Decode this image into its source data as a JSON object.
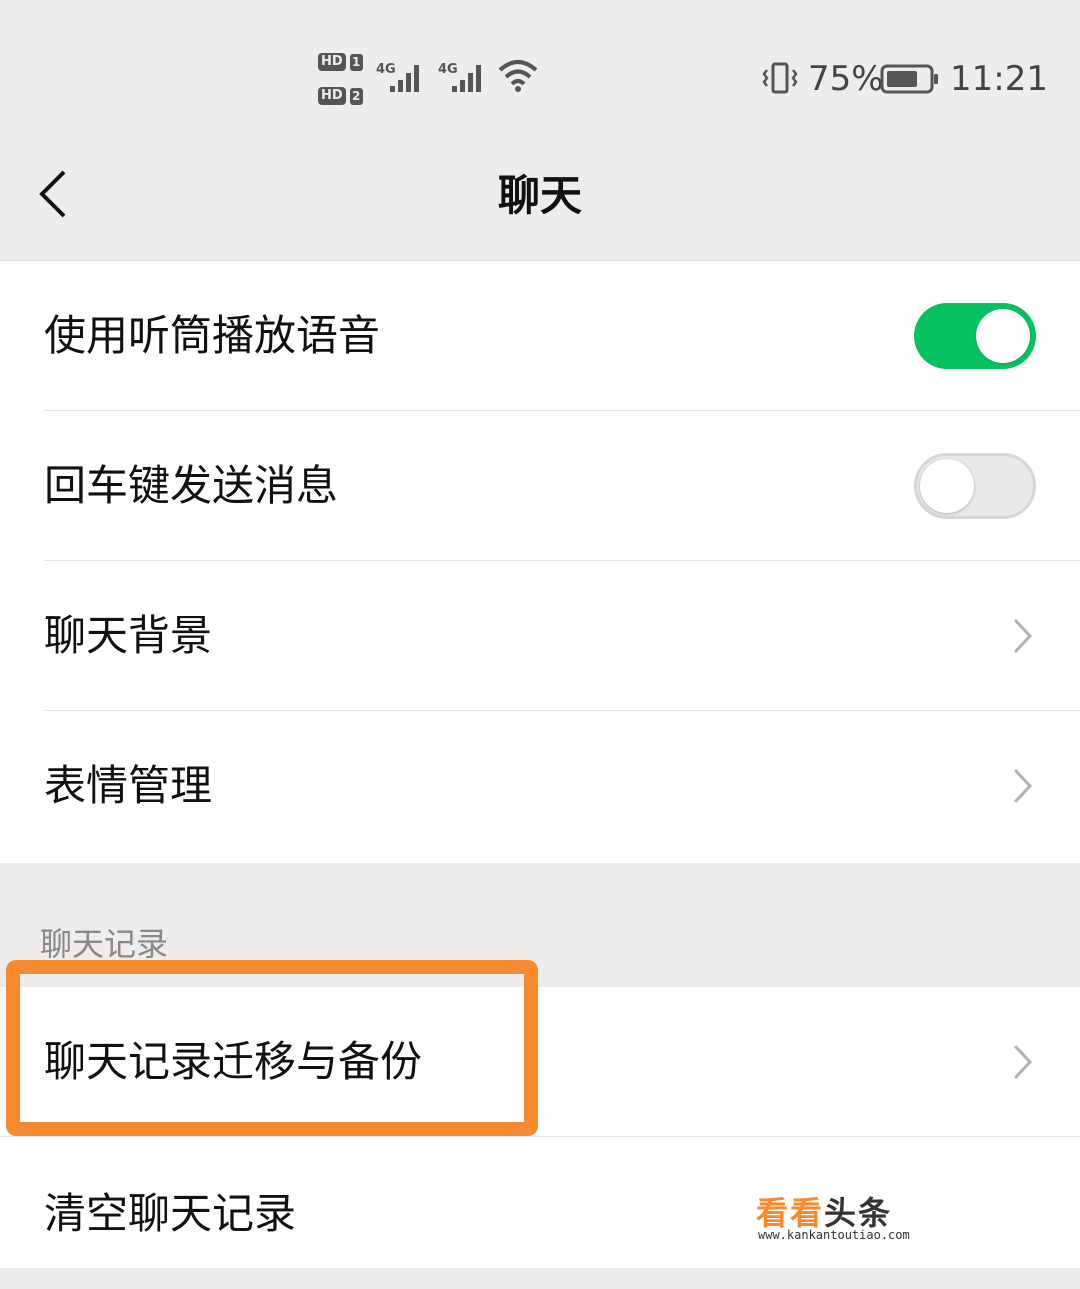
{
  "status_bar": {
    "hd_label": "HD",
    "sim1": "1",
    "sim2": "2",
    "net1": "4G",
    "net2": "4G",
    "battery_percent": "75%",
    "time": "11:21"
  },
  "nav": {
    "title": "聊天",
    "back_icon": "chevron-left-icon"
  },
  "settings": {
    "items": [
      {
        "label": "使用听筒播放语音",
        "control": "toggle",
        "on": true
      },
      {
        "label": "回车键发送消息",
        "control": "toggle",
        "on": false
      },
      {
        "label": "聊天背景",
        "control": "chevron"
      },
      {
        "label": "表情管理",
        "control": "chevron"
      }
    ]
  },
  "chat_history": {
    "section_title": "聊天记录",
    "items": [
      {
        "label": "聊天记录迁移与备份",
        "control": "chevron"
      },
      {
        "label": "清空聊天记录"
      }
    ]
  },
  "watermark": {
    "brand_a": "看看",
    "brand_b": "头条",
    "url": "www.kankantoutiao.com"
  },
  "colors": {
    "toggle_on": "#07c160",
    "highlight": "#f78a30",
    "background": "#ededed"
  }
}
